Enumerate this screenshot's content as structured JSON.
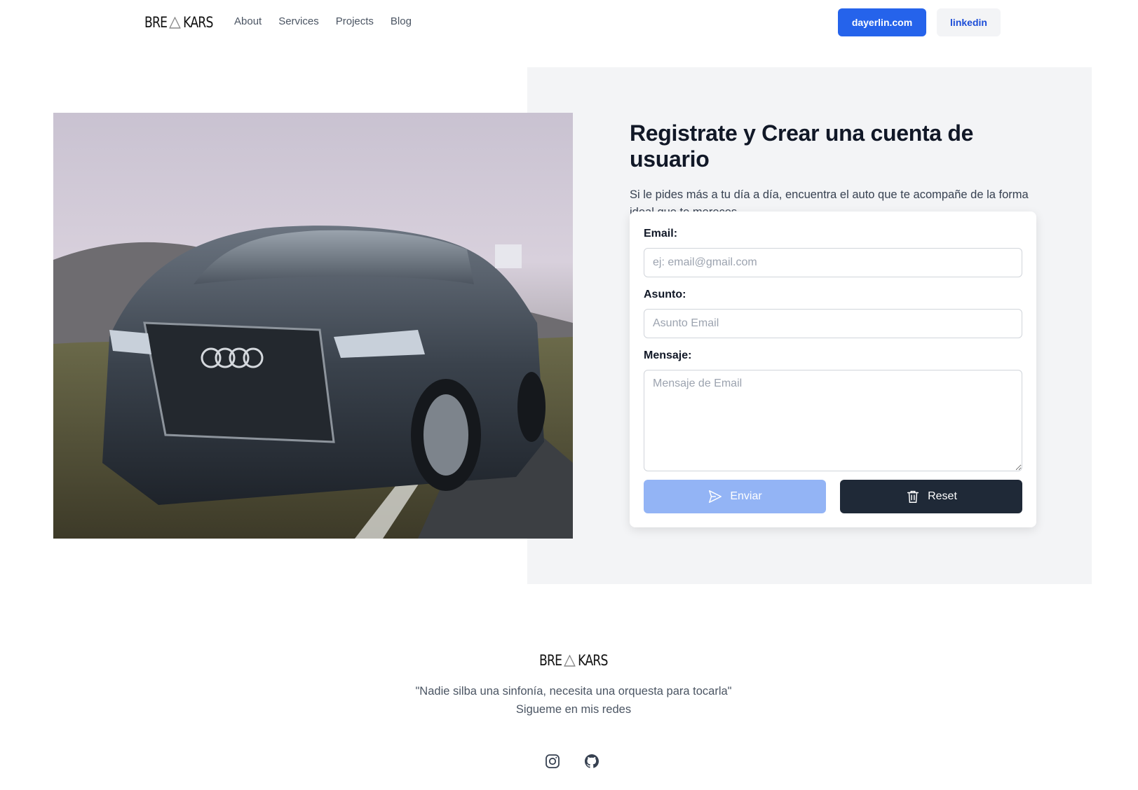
{
  "nav": {
    "logo_left": "BRE",
    "logo_right": "KARS",
    "links": [
      "About",
      "Services",
      "Projects",
      "Blog"
    ],
    "primary_button": "dayerlin.com",
    "secondary_button": "linkedin"
  },
  "hero": {
    "title": "Registrate y Crear una cuenta de usuario",
    "description": "Si le pides más a tu día a día, encuentra el auto que te acompañe de la forma ideal que te mereces."
  },
  "form": {
    "email_label": "Email:",
    "email_placeholder": "ej: email@gmail.com",
    "subject_label": "Asunto:",
    "subject_placeholder": "Asunto Email",
    "message_label": "Mensaje:",
    "message_placeholder": "Mensaje de Email",
    "submit_label": "Enviar",
    "reset_label": "Reset"
  },
  "footer": {
    "logo_left": "BRE",
    "logo_right": "KARS",
    "quote": "\"Nadie silba una sinfonía, necesita una orquesta para tocarla\"",
    "follow": "Sigueme en mis redes",
    "icons": [
      "instagram-icon",
      "github-icon"
    ]
  },
  "colors": {
    "primary": "#2563eb",
    "primary_disabled": "#93b4f5",
    "dark_button": "#1f2937",
    "panel_bg": "#f3f4f6"
  }
}
